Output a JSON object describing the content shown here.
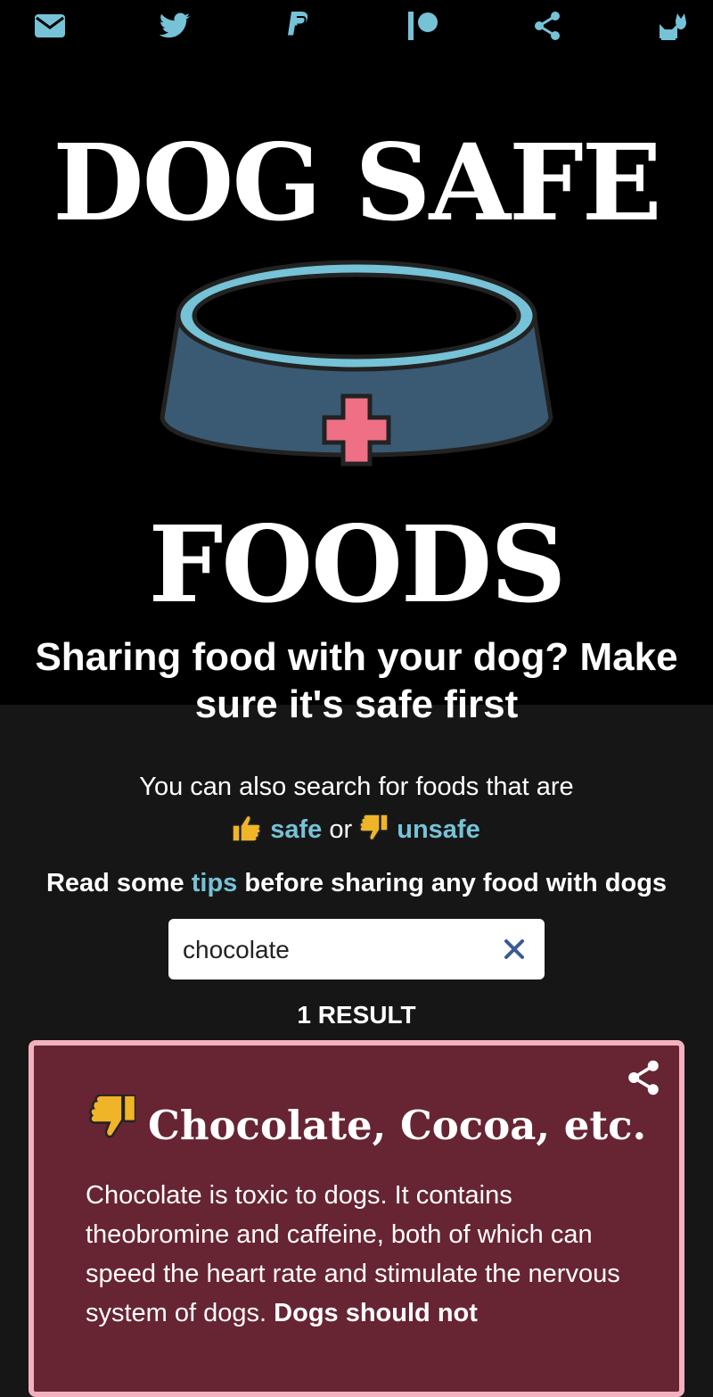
{
  "nav": {
    "icons": [
      "envelope-icon",
      "twitter-icon",
      "paypal-icon",
      "patreon-icon",
      "share-icon",
      "cat-icon"
    ]
  },
  "hero": {
    "title_top": "DOG SAFE",
    "title_bottom": "FOODS",
    "tagline": "Sharing food with your dog? Make sure it's safe first"
  },
  "search_note": {
    "prefix": "You can also search for foods that are",
    "safe_link": "safe",
    "or": "or",
    "unsafe_link": "unsafe"
  },
  "tips": {
    "before": "Read some",
    "link": "tips",
    "after": "before sharing any food with dogs"
  },
  "search": {
    "value": "chocolate"
  },
  "results": {
    "count_label": "1 RESULT"
  },
  "card": {
    "title": "Chocolate, Cocoa, etc.",
    "body": "Chocolate is toxic to dogs. It contains theobromine and caffeine, both of which can speed the heart rate and stimulate the nervous system of dogs.",
    "body_bold": "Dogs should not"
  },
  "colors": {
    "accent": "#76c2d6",
    "card_bg": "#672432",
    "card_border": "#f3b1c0",
    "page_bg": "#161616",
    "cross": "#ef6f85",
    "bowl": "#3a5a73"
  }
}
